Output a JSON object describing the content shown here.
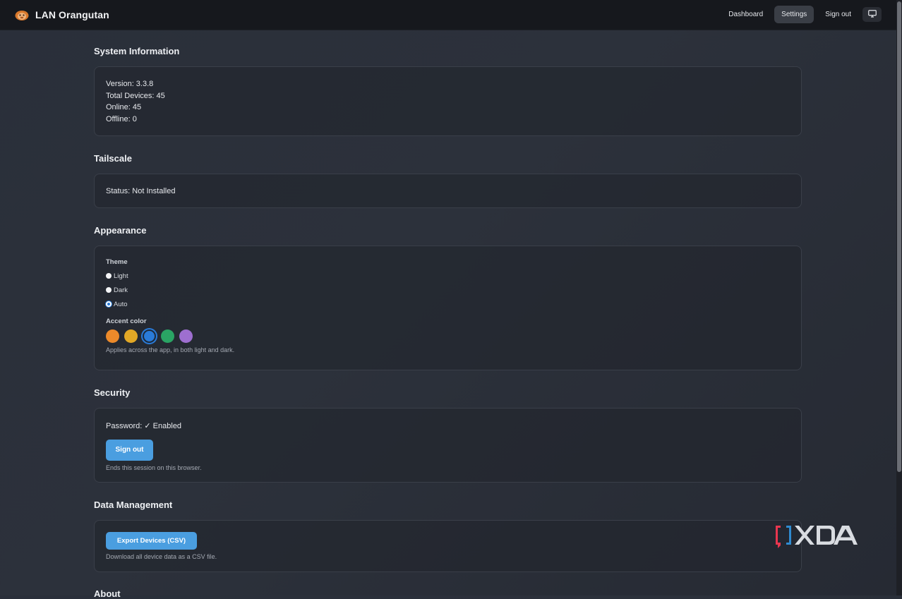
{
  "app": {
    "title": "LAN Orangutan",
    "logo_icon": "orangutan-logo-icon"
  },
  "nav": {
    "items": [
      {
        "label": "Dashboard",
        "active": false
      },
      {
        "label": "Settings",
        "active": true
      },
      {
        "label": "Sign out",
        "active": false
      }
    ],
    "display_icon": "monitor-icon"
  },
  "system": {
    "title": "System Information",
    "version": "Version: 3.3.8",
    "total_devices": "Total Devices: 45",
    "online": "Online: 45",
    "offline": "Offline: 0"
  },
  "tailscale": {
    "title": "Tailscale",
    "status": "Status: Not Installed"
  },
  "appearance": {
    "title": "Appearance",
    "theme_label": "Theme",
    "themes": [
      {
        "label": "Light",
        "checked": false
      },
      {
        "label": "Dark",
        "checked": false
      },
      {
        "label": "Auto",
        "checked": true
      }
    ],
    "accent_label": "Accent color",
    "accents": [
      {
        "color": "#ec8a2a",
        "selected": false
      },
      {
        "color": "#e2a826",
        "selected": false
      },
      {
        "color": "#2a7bd8",
        "selected": true
      },
      {
        "color": "#2aa464",
        "selected": false
      },
      {
        "color": "#9e6fd0",
        "selected": false
      }
    ],
    "accent_hint": "Applies across the app, in both light and dark."
  },
  "security": {
    "title": "Security",
    "password_status": "Password: ✓ Enabled",
    "signout_label": "Sign out",
    "signout_hint": "Ends this session on this browser."
  },
  "data_management": {
    "title": "Data Management",
    "export_label": "Export Devices (CSV)",
    "export_hint": "Download all device data as a CSV file."
  },
  "about": {
    "title": "About"
  },
  "watermark": {
    "text": "XDA",
    "accent_color": "#e8364f",
    "secondary_color": "#2f8bd0"
  }
}
